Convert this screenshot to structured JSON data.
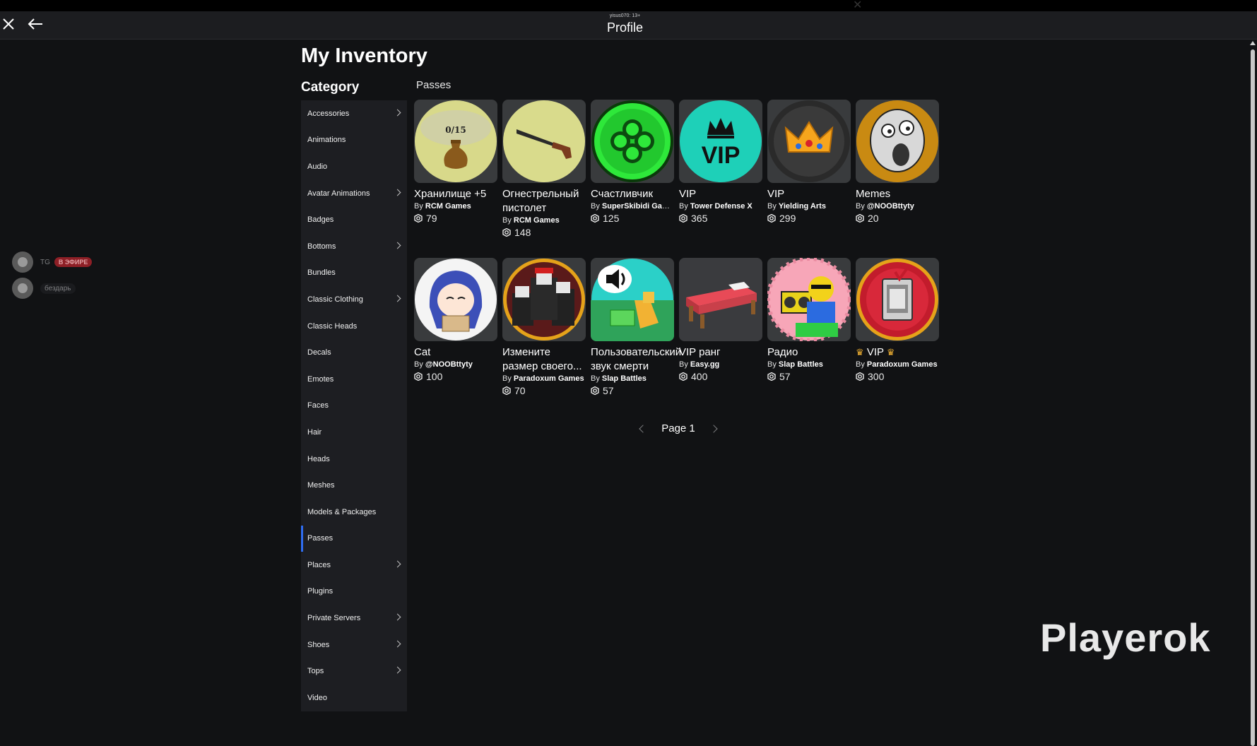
{
  "window": {
    "user_line": "yisus070: 13+",
    "title": "Profile"
  },
  "stream_panel": {
    "rows": [
      {
        "label": "TG",
        "badge": "В ЭФИРЕ"
      },
      {
        "label": "бездарь"
      }
    ]
  },
  "page": {
    "title": "My Inventory",
    "category_title": "Category",
    "section_title": "Passes"
  },
  "sidebar": {
    "items": [
      {
        "label": "Accessories",
        "chevron": true
      },
      {
        "label": "Animations",
        "chevron": false
      },
      {
        "label": "Audio",
        "chevron": false
      },
      {
        "label": "Avatar Animations",
        "chevron": true
      },
      {
        "label": "Badges",
        "chevron": false
      },
      {
        "label": "Bottoms",
        "chevron": true
      },
      {
        "label": "Bundles",
        "chevron": false
      },
      {
        "label": "Classic Clothing",
        "chevron": true
      },
      {
        "label": "Classic Heads",
        "chevron": false
      },
      {
        "label": "Decals",
        "chevron": false
      },
      {
        "label": "Emotes",
        "chevron": false
      },
      {
        "label": "Faces",
        "chevron": false
      },
      {
        "label": "Hair",
        "chevron": false
      },
      {
        "label": "Heads",
        "chevron": false
      },
      {
        "label": "Meshes",
        "chevron": false
      },
      {
        "label": "Models & Packages",
        "chevron": false
      },
      {
        "label": "Passes",
        "chevron": false,
        "active": true
      },
      {
        "label": "Places",
        "chevron": true
      },
      {
        "label": "Plugins",
        "chevron": false
      },
      {
        "label": "Private Servers",
        "chevron": true
      },
      {
        "label": "Shoes",
        "chevron": true
      },
      {
        "label": "Tops",
        "chevron": true
      },
      {
        "label": "Video",
        "chevron": false
      }
    ]
  },
  "items": [
    {
      "name": "Хранилище +5",
      "by": "RCM Games",
      "price": "79",
      "thumb_icon": "sack-icon",
      "thumb_text": "0/15"
    },
    {
      "name": "Огнестрельный пистолет",
      "by": "RCM Games",
      "price": "148",
      "thumb_icon": "shotgun-icon"
    },
    {
      "name": "Счастливчик",
      "by": "SuperSkibidi Gam...",
      "price": "125",
      "thumb_icon": "clover-icon"
    },
    {
      "name": "VIP",
      "by": "Tower Defense X",
      "price": "365",
      "thumb_icon": "vip-crown-icon",
      "thumb_text": "VIP"
    },
    {
      "name": "VIP",
      "by": "Yielding Arts",
      "price": "299",
      "thumb_icon": "gold-crown-icon"
    },
    {
      "name": "Memes",
      "by": "@NOOBttyty",
      "price": "20",
      "thumb_icon": "meme-face-icon"
    },
    {
      "name": "Cat",
      "by": "@NOOBttyty",
      "price": "100",
      "thumb_icon": "anime-cat-icon"
    },
    {
      "name": "Измените размер своего...",
      "by": "Paradoxum Games",
      "price": "70",
      "thumb_icon": "resize-avatars-icon"
    },
    {
      "name": "Пользовательский звук смерти",
      "by": "Slap Battles",
      "price": "57",
      "thumb_icon": "speaker-icon"
    },
    {
      "name": "VIP ранг",
      "by": "Easy.gg",
      "price": "400",
      "thumb_icon": "bed-icon"
    },
    {
      "name": "Радио",
      "by": "Slap Battles",
      "price": "57",
      "thumb_icon": "boombox-icon"
    },
    {
      "name": "VIP",
      "by": "Paradoxum Games",
      "price": "300",
      "thumb_icon": "vip-card-icon",
      "crowned": true
    }
  ],
  "by_prefix": "By",
  "pager": {
    "label": "Page 1"
  },
  "watermark": "Playerok",
  "colors": {
    "accent": "#2f6cf0",
    "background": "#111214",
    "sidebar": "#1d1e22",
    "live_badge": "#8e1f26"
  }
}
